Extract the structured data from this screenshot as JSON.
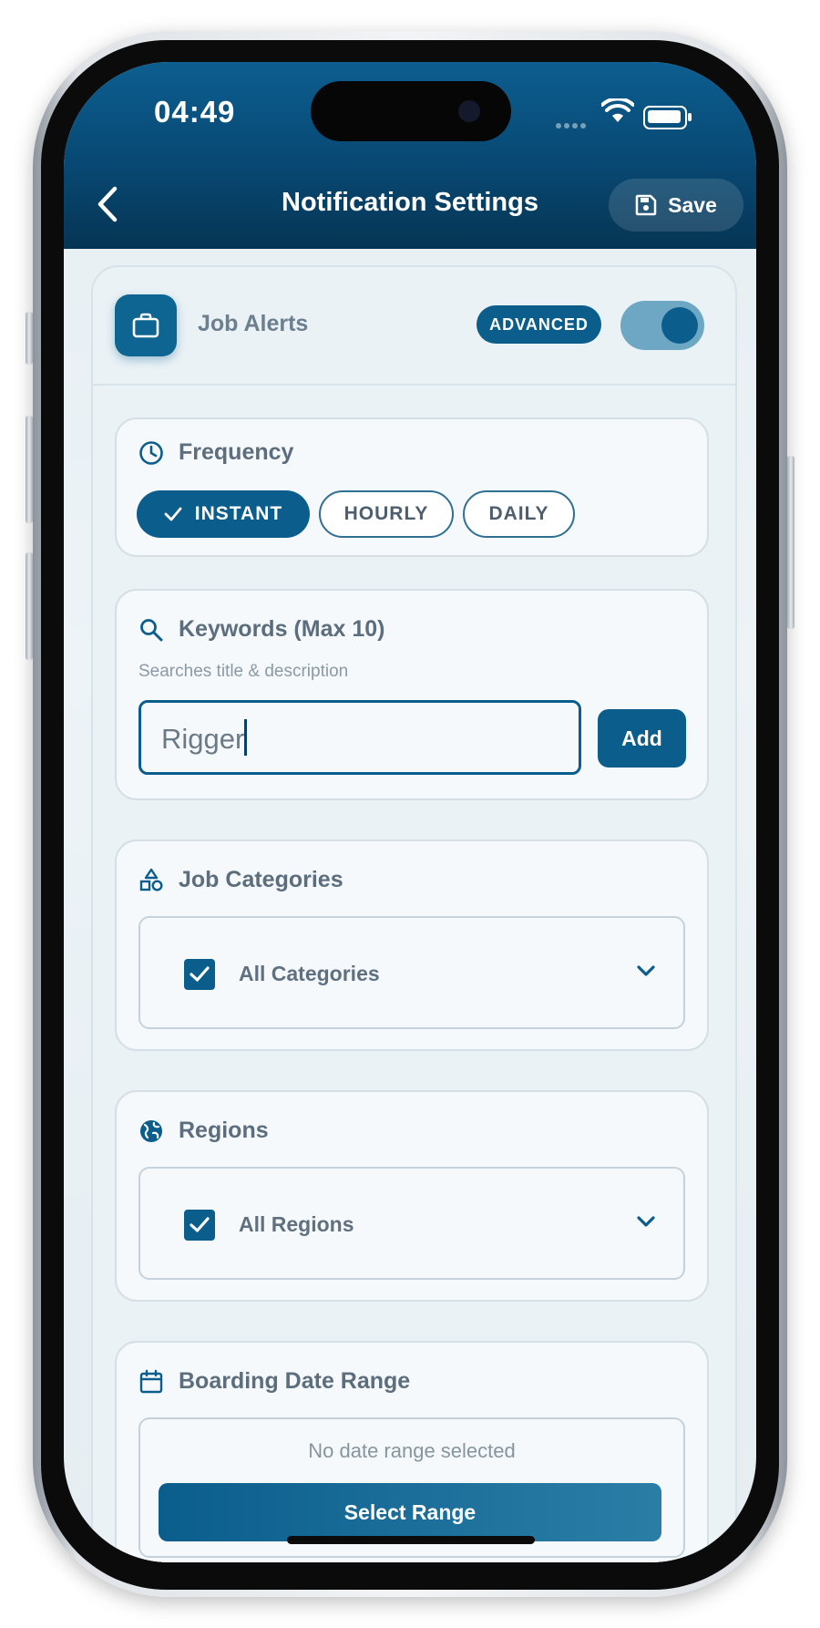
{
  "status_bar": {
    "time": "04:49"
  },
  "header": {
    "title": "Notification Settings",
    "save_label": "Save"
  },
  "job_alerts": {
    "label": "Job Alerts",
    "badge": "ADVANCED",
    "enabled": true
  },
  "frequency": {
    "title": "Frequency",
    "options": [
      {
        "label": "INSTANT",
        "selected": true
      },
      {
        "label": "HOURLY",
        "selected": false
      },
      {
        "label": "DAILY",
        "selected": false
      }
    ]
  },
  "keywords": {
    "title": "Keywords (Max 10)",
    "hint": "Searches title & description",
    "input_value": "Rigger",
    "add_label": "Add"
  },
  "job_categories": {
    "title": "Job Categories",
    "selected_label": "All Categories",
    "checked": true
  },
  "regions": {
    "title": "Regions",
    "selected_label": "All Regions",
    "checked": true
  },
  "boarding_date": {
    "title": "Boarding Date Range",
    "empty_text": "No date range selected",
    "button_label": "Select Range"
  },
  "colors": {
    "header": "#084873",
    "accent": "#0b5e8c",
    "toggle_track": "#6ea7c3",
    "background": "#e6eef3"
  }
}
